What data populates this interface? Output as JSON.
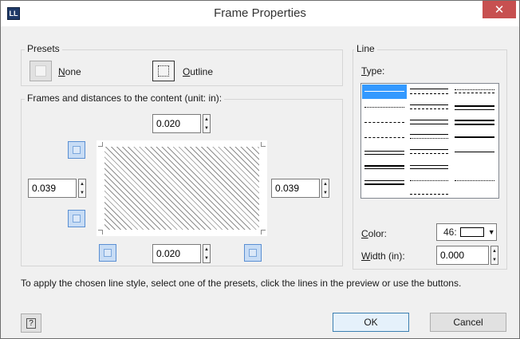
{
  "window": {
    "app_icon": "LL",
    "title": "Frame Properties",
    "close_glyph": "✕"
  },
  "presets": {
    "group_label": "Presets",
    "none_accel": "N",
    "none_rest": "one",
    "outline_accel": "O",
    "outline_rest": "utline"
  },
  "frames": {
    "group_label": "Frames and distances to the content (unit: in):",
    "top_value": "0.020",
    "bottom_value": "0.020",
    "left_value": "0.039",
    "right_value": "0.039"
  },
  "line": {
    "group_label": "Line",
    "type_accel": "T",
    "type_rest": "ype:",
    "color_accel": "C",
    "color_rest": "olor:",
    "color_value": "46:",
    "width_accel": "W",
    "width_rest": "idth (in):",
    "width_value": "0.000"
  },
  "hint": "To apply the chosen line style, select one of the presets, click the lines in the preview or use the buttons.",
  "footer": {
    "help_glyph": "?",
    "ok_label": "OK",
    "cancel_label": "Cancel"
  },
  "colors": {
    "selection": "#3399ff",
    "accent_button": "#c7dcf5",
    "close": "#c75050"
  }
}
